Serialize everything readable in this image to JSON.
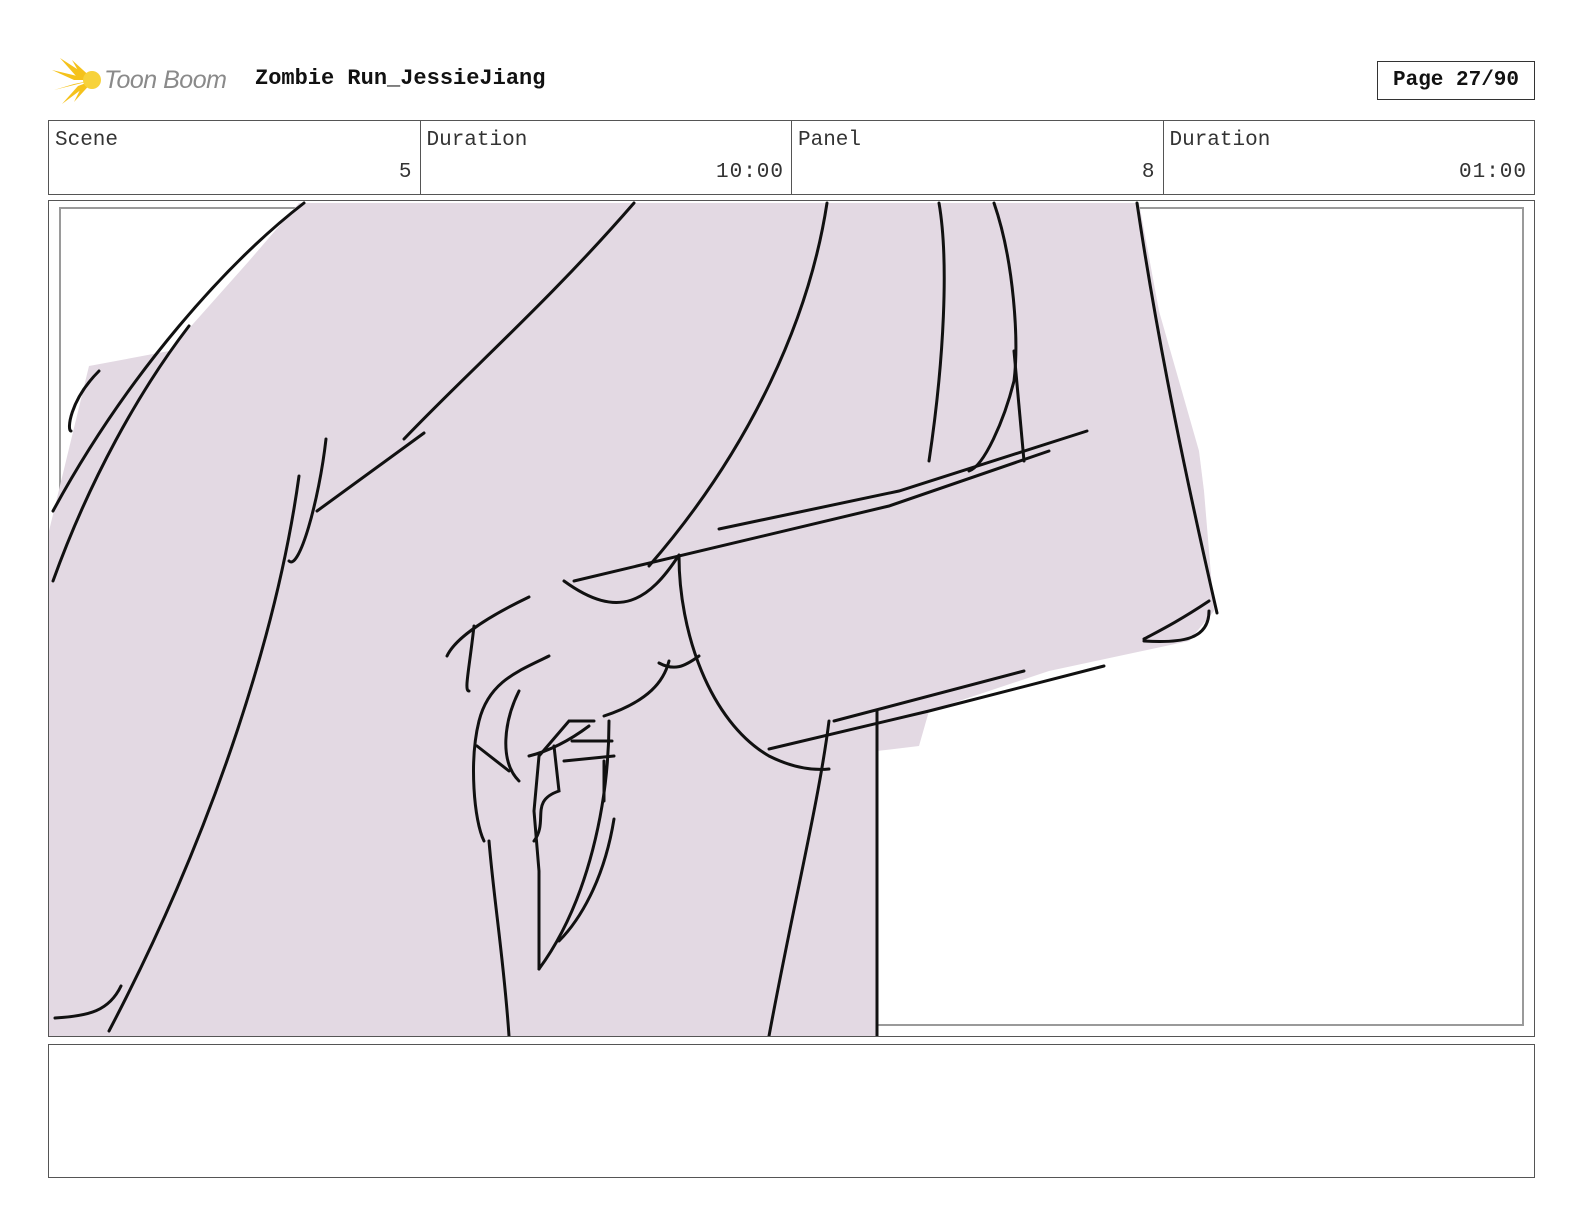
{
  "header": {
    "logo_text": "Toon Boom",
    "project_title": "Zombie Run_JessieJiang",
    "page_label": "Page 27/90"
  },
  "info": {
    "scene_label": "Scene",
    "scene_value": "5",
    "scene_duration_label": "Duration",
    "scene_duration_value": "10:00",
    "panel_label": "Panel",
    "panel_value": "8",
    "panel_duration_label": "Duration",
    "panel_duration_value": "01:00"
  },
  "panel": {
    "fill_color": "#e3d9e3",
    "line_color": "#111111"
  },
  "notes": {
    "text": ""
  }
}
